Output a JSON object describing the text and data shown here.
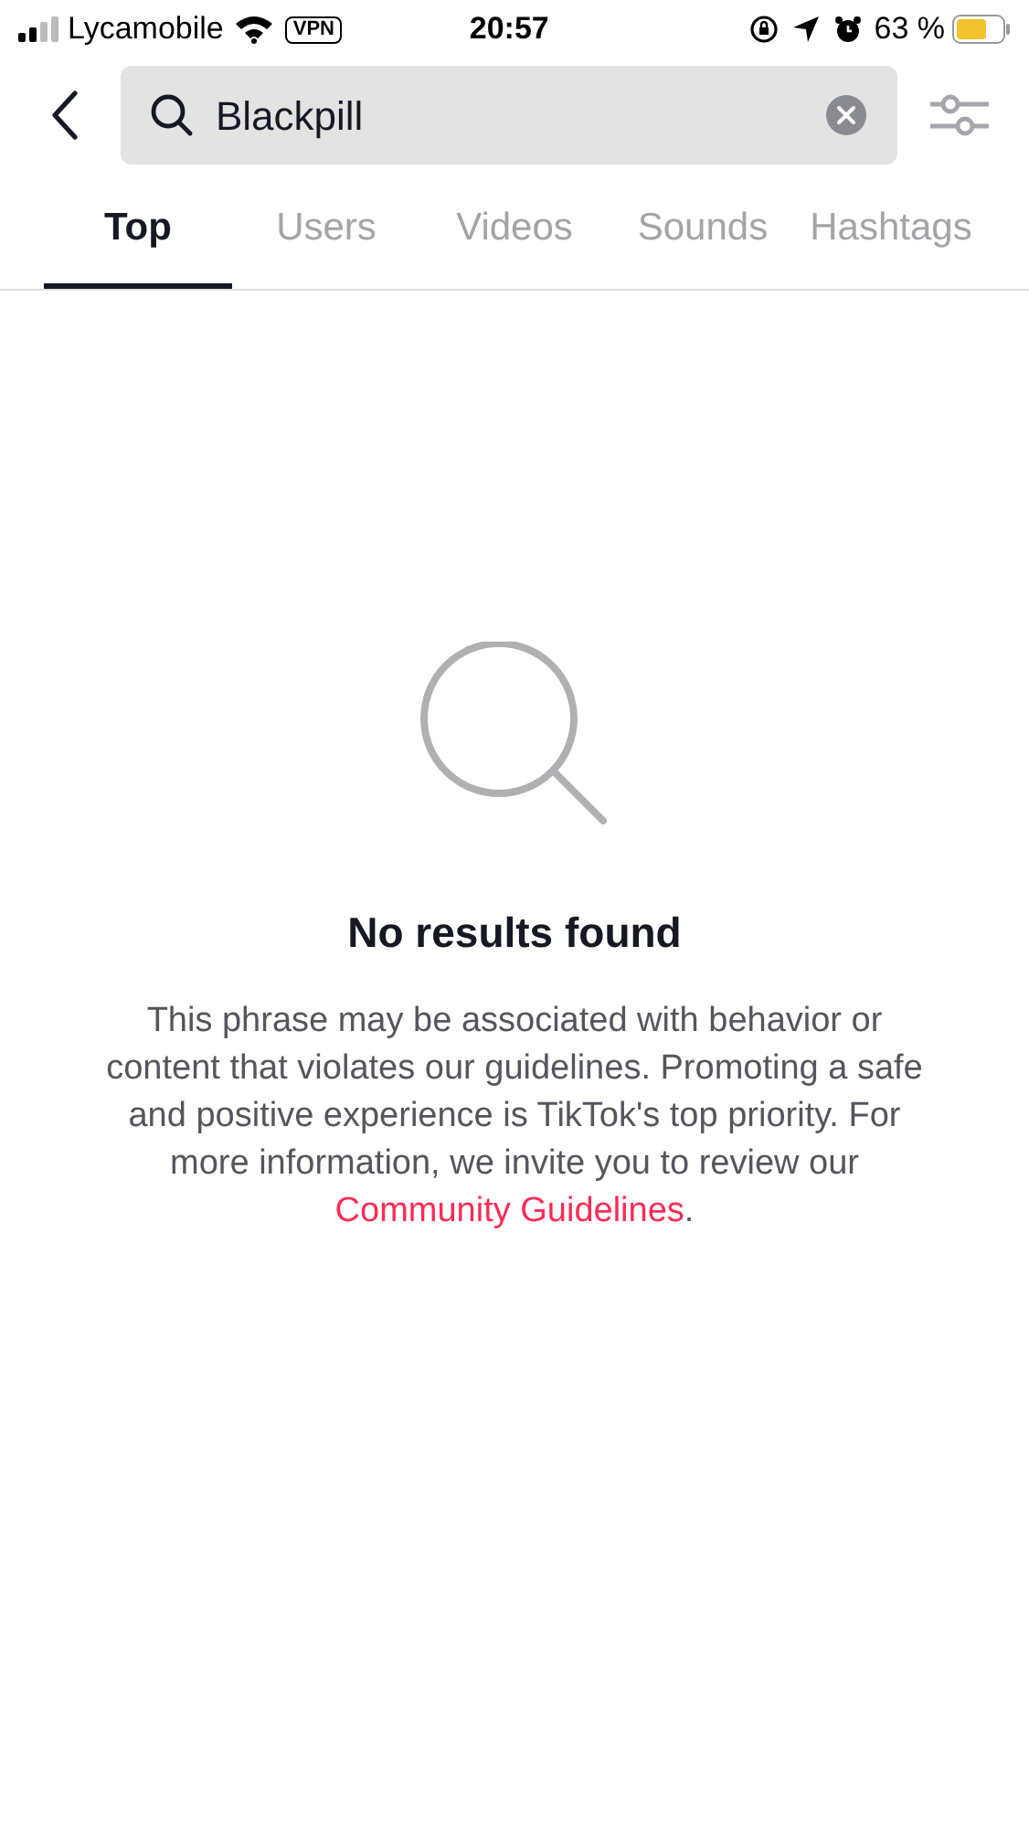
{
  "status_bar": {
    "carrier": "Lycamobile",
    "vpn": "VPN",
    "time": "20:57",
    "battery_percent": "63 %"
  },
  "search": {
    "value": "Blackpill"
  },
  "tabs": [
    {
      "label": "Top",
      "selected": true
    },
    {
      "label": "Users",
      "selected": false
    },
    {
      "label": "Videos",
      "selected": false
    },
    {
      "label": "Sounds",
      "selected": false
    },
    {
      "label": "Hashtags",
      "selected": false
    }
  ],
  "empty_state": {
    "title": "No results found",
    "message": "This phrase may be associated with behavior or content that violates our guidelines. Promoting a safe and positive experience is TikTok's top priority. For more information, we invite you to review our ",
    "link": "Community Guidelines",
    "message_end": "."
  }
}
